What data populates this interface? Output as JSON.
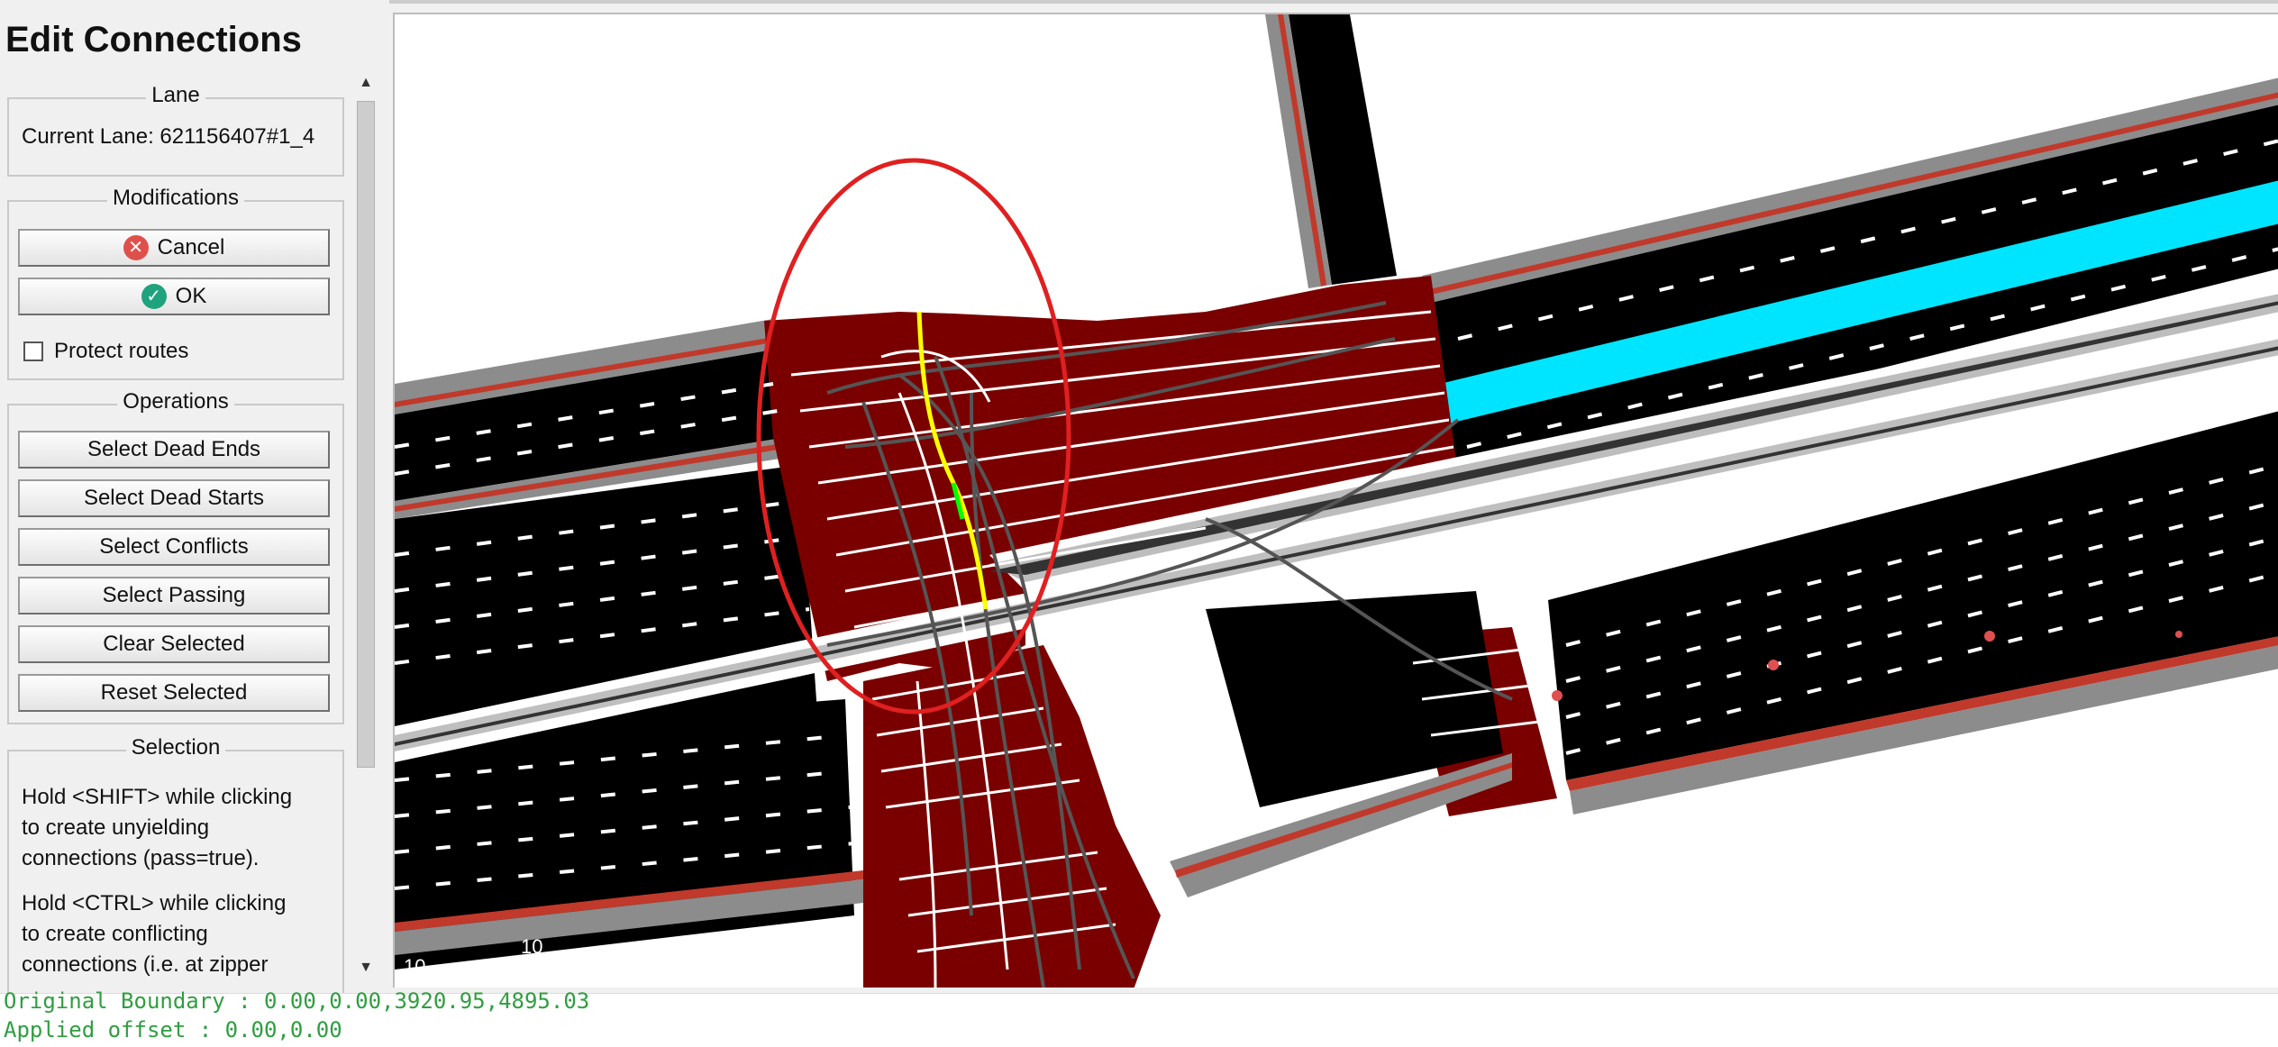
{
  "panel": {
    "title": "Edit Connections",
    "lane": {
      "group_label": "Lane",
      "current_lane": "Current Lane: 621156407#1_4"
    },
    "modifications": {
      "group_label": "Modifications",
      "cancel_label": "Cancel",
      "ok_label": "OK",
      "protect_routes_label": "Protect routes",
      "protect_routes_checked": false
    },
    "operations": {
      "group_label": "Operations",
      "buttons": [
        "Select Dead Ends",
        "Select Dead Starts",
        "Select Conflicts",
        "Select Passing",
        "Clear Selected",
        "Reset Selected"
      ]
    },
    "selection": {
      "group_label": "Selection",
      "help1": [
        "Hold <SHIFT> while clicking",
        "to create unyielding",
        "connections (pass=true)."
      ],
      "help2": [
        "Hold <CTRL> while clicking",
        "to create conflicting",
        "connections (i.e. at zipper"
      ]
    }
  },
  "map": {
    "labels": [
      "10",
      "10"
    ],
    "colors": {
      "junction": "#7a0000",
      "road": "#000000",
      "sidewalk": "#888888",
      "curb": "#c0392b",
      "highlight_lane": "#00ffff",
      "selected_connection": "#ffff00",
      "annotation_ellipse": "#e02020"
    }
  },
  "status": {
    "line1": "Original Boundary  : 0.00,0.00,3920.95,4895.03",
    "line2": "Applied offset     : 0.00,0.00"
  }
}
